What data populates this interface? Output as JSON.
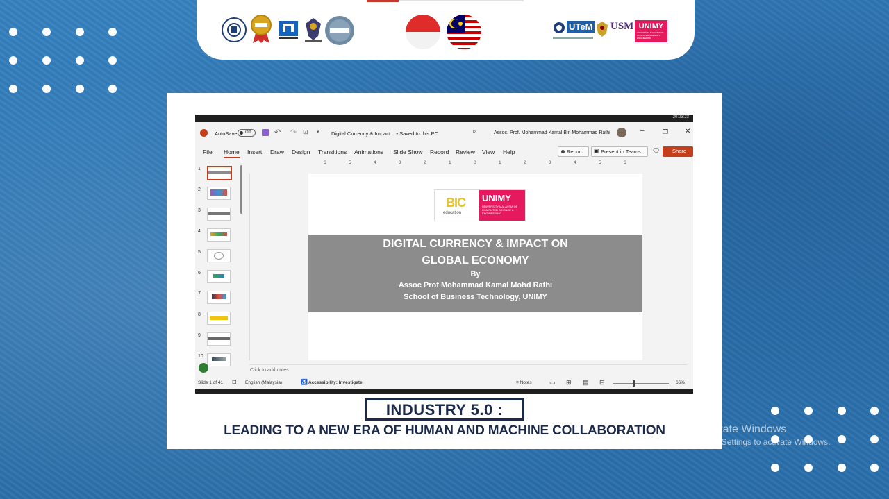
{
  "header": {
    "partner_logos": [
      "university-seal-logo",
      "award-badge-logo",
      "institution-logo",
      "crest-logo",
      "circle-badge-logo"
    ],
    "flags": [
      "indonesia-flag",
      "malaysia-flag"
    ],
    "right_logos": {
      "utem": "UTeM",
      "usm": "USM",
      "unimy": "UNIMY",
      "unimy_sub": "UNIVERSITY MALAYSIA OF COMPUTER SCIENCE & ENGINEERING"
    }
  },
  "ppt": {
    "autosave_label": "AutoSave",
    "autosave_state": "Off",
    "doc_title": "Digital Currency & Impact... • Saved to this PC",
    "user_name": "Assoc. Prof. Mohammad Kamal Bin Mohammad Rathi",
    "menu": [
      "File",
      "Home",
      "Insert",
      "Draw",
      "Design",
      "Transitions",
      "Animations",
      "Slide Show",
      "Record",
      "Review",
      "View",
      "Help"
    ],
    "record_btn": "Record",
    "present_btn": "Present in Teams",
    "share_btn": "Share",
    "thumbnail_numbers": [
      "1",
      "2",
      "3",
      "4",
      "5",
      "6",
      "7",
      "8",
      "9",
      "10"
    ],
    "ruler_numbers": [
      "6",
      "5",
      "4",
      "3",
      "2",
      "1",
      "0",
      "1",
      "2",
      "3",
      "4",
      "5",
      "6"
    ],
    "slide": {
      "logo_left": "BIC",
      "logo_left_sub": "education",
      "logo_right": "UNIMY",
      "logo_right_sub": "UNIVERSITY MALAYSIA OF COMPUTER SCIENCE & ENGINEERING",
      "title_line1": "DIGITAL CURRENCY & IMPACT ON",
      "title_line2": "GLOBAL ECONOMY",
      "by": "By",
      "author": "Assoc Prof Mohammad Kamal Mohd Rathi",
      "school": "School of Business Technology, UNIMY"
    },
    "notes_placeholder": "Click to add notes",
    "status": {
      "slide_count": "Slide 1 of 41",
      "language": "English (Malaysia)",
      "accessibility": "Accessibility: Investigate",
      "notes": "Notes",
      "zoom": "66%"
    },
    "clock": "20:03:23"
  },
  "banner": {
    "title": "INDUSTRY 5.0 :",
    "subtitle": "LEADING TO A NEW ERA OF HUMAN AND MACHINE COLLABORATION"
  },
  "watermark": {
    "line1": "Activate Windows",
    "line2": "Go to Settings to activate Windows."
  },
  "colors": {
    "background": "#2e78b6",
    "banner_text": "#1b2a4a",
    "ppt_accent": "#c43e1c",
    "unimy_pink": "#e6195e",
    "slide_band": "#8c8c8c"
  }
}
